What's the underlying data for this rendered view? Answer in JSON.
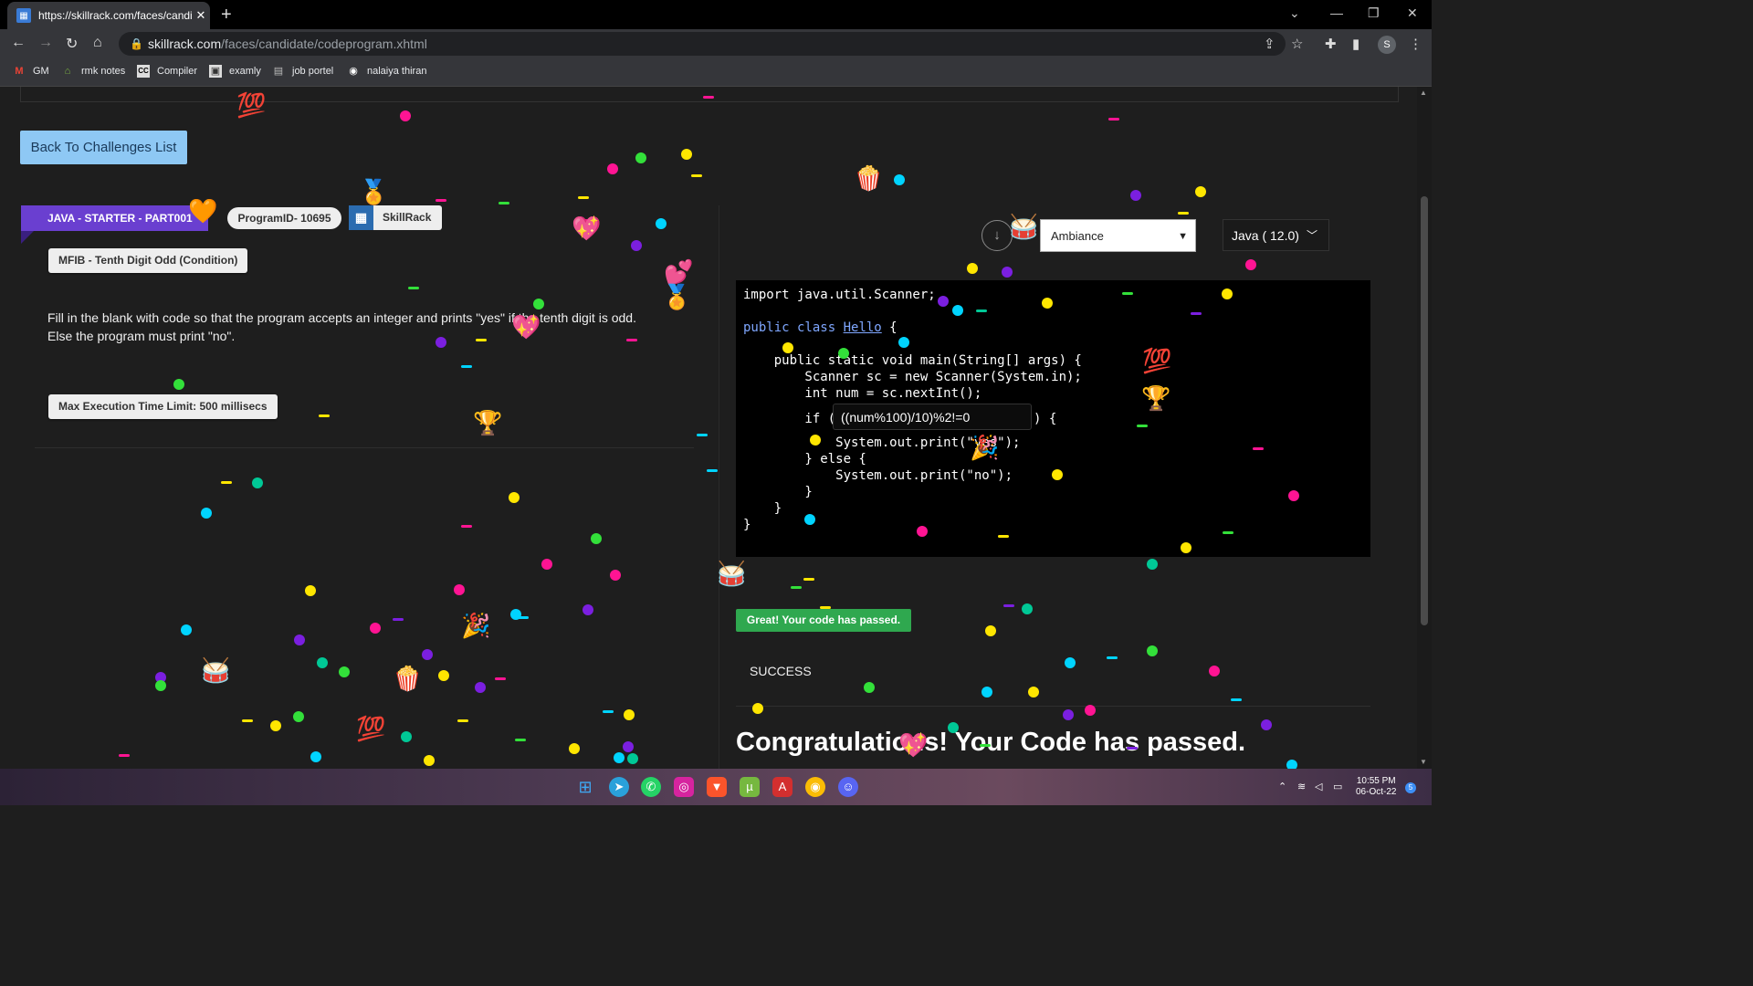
{
  "browser": {
    "tab_title": "https://skillrack.com/faces/candidat",
    "url_host": "skillrack.com",
    "url_path": "/faces/candidate/codeprogram.xhtml",
    "profile_initial": "S",
    "bookmarks": [
      {
        "label": "GM",
        "icon": "gmail-icon"
      },
      {
        "label": "rmk notes",
        "icon": "house-icon"
      },
      {
        "label": "Compiler",
        "icon": "cc-icon"
      },
      {
        "label": "examly",
        "icon": "examly-icon"
      },
      {
        "label": "job portel",
        "icon": "job-icon"
      },
      {
        "label": "nalaiya thiran",
        "icon": "globe-icon"
      }
    ]
  },
  "page": {
    "back_button": "Back To Challenges List",
    "category": "JAVA - STARTER - PART001",
    "program_id": "ProgramID- 10695",
    "brand": "SkillRack",
    "problem_title": "MFIB - Tenth Digit Odd (Condition)",
    "description_line1": "Fill in the blank with code so that the program accepts an integer and prints \"yes\" if the tenth digit is odd.",
    "description_line2": "Else the program must print \"no\".",
    "time_limit": "Max Execution Time Limit: 500 millisecs",
    "theme_select": "Ambiance",
    "language_select": "Java ( 12.0)",
    "code": {
      "import": "import java.util.Scanner;",
      "class_kw": "public class",
      "class_name": "Hello",
      "brace_open": " {",
      "main_sig": "    public static void main(String[] args) {",
      "scanner": "        Scanner sc = new Scanner(System.in);",
      "num": "        int num = sc.nextInt();",
      "if_open": "        if (",
      "if_close": ") {",
      "print_yes": "            System.out.print(\"yes\");",
      "else": "        } else {",
      "print_no": "            System.out.print(\"no\");",
      "close_if": "        }",
      "close_main": "    }",
      "close_class": "}"
    },
    "blank_value": "((num%100)/10)%2!=0",
    "passed_badge": "Great! Your code has passed.",
    "status": "SUCCESS",
    "congrats": "Congratulations! Your Code has passed."
  },
  "taskbar": {
    "time": "10:55 PM",
    "date": "06-Oct-22",
    "notifications": "5"
  },
  "colors": {
    "ribbon": "#6a3fd0",
    "back_button": "#8ec8f4",
    "success_badge": "#2fa84f",
    "confetti": [
      "#ff1493",
      "#ffe600",
      "#00d4ff",
      "#7b1fe0",
      "#33e03a",
      "#00c896"
    ]
  }
}
